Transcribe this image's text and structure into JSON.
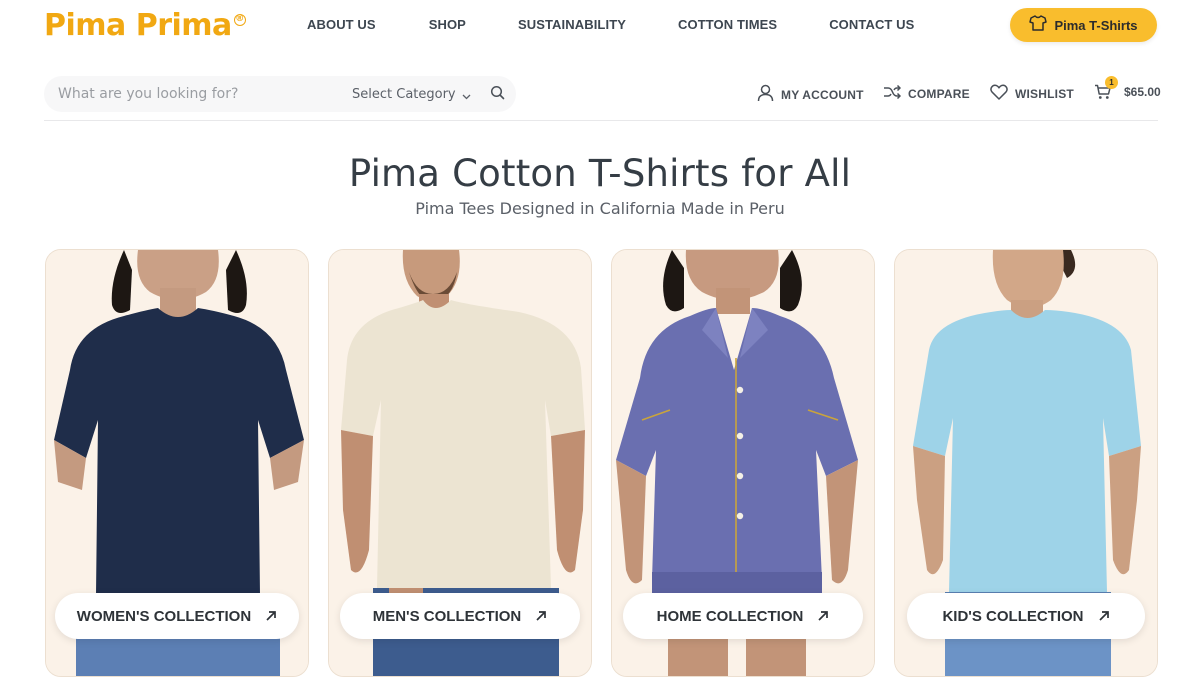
{
  "brand": {
    "logo_text": "Pima Prima",
    "registered_mark": "®",
    "accent_color": "#f9bd2d",
    "logo_color": "#f1a812"
  },
  "nav": {
    "items": [
      {
        "label": "ABOUT US"
      },
      {
        "label": "SHOP"
      },
      {
        "label": "SUSTAINABILITY"
      },
      {
        "label": "COTTON TIMES"
      },
      {
        "label": "CONTACT US"
      }
    ],
    "cta_label": "Pima T-Shirts",
    "cta_icon": "tshirt-icon"
  },
  "search": {
    "placeholder": "What are you looking for?",
    "category_label": "Select Category",
    "icon": "search-icon"
  },
  "utility": {
    "account_label": "MY ACCOUNT",
    "compare_label": "COMPARE",
    "wishlist_label": "WISHLIST",
    "cart_count": "1",
    "cart_total": "$65.00"
  },
  "hero": {
    "title": "Pima Cotton T-Shirts for All",
    "subtitle": "Pima Tees Designed in California Made in Peru"
  },
  "collections": [
    {
      "label": "WOMEN'S COLLECTION",
      "shirt_color": "#1f2d4a"
    },
    {
      "label": "MEN'S COLLECTION",
      "shirt_color": "#ece4d2"
    },
    {
      "label": "HOME COLLECTION",
      "shirt_color": "#6a6fb0"
    },
    {
      "label": "KID'S COLLECTION",
      "shirt_color": "#9ed3e8"
    }
  ]
}
